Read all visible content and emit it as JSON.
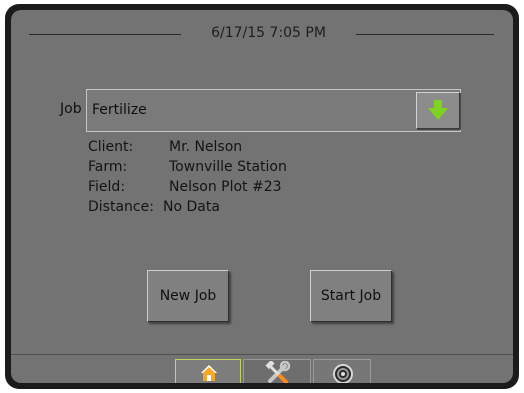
{
  "header": {
    "datetime": "6/17/15 7:05 PM"
  },
  "job": {
    "label": "Job",
    "value": "Fertilize",
    "dropdown_icon": "green-down-arrow-icon"
  },
  "details": {
    "client_label": "Client:",
    "client_value": "Mr. Nelson",
    "farm_label": "Farm:",
    "farm_value": "Townville Station",
    "field_label": "Field:",
    "field_value": "Nelson Plot #23",
    "distance_label": "Distance:",
    "distance_value": "No Data"
  },
  "buttons": {
    "new_job": "New Job",
    "start_job": "Start Job"
  },
  "tabs": [
    {
      "name": "home",
      "icon": "home-icon",
      "selected": true
    },
    {
      "name": "tools",
      "icon": "tools-icon",
      "selected": false
    },
    {
      "name": "gauge",
      "icon": "gauge-icon",
      "selected": false
    }
  ],
  "colors": {
    "screen_bg": "#737373",
    "accent_green": "#7ed321",
    "home_orange": "#f5a623",
    "selected_tab_border": "#c6d35a"
  }
}
